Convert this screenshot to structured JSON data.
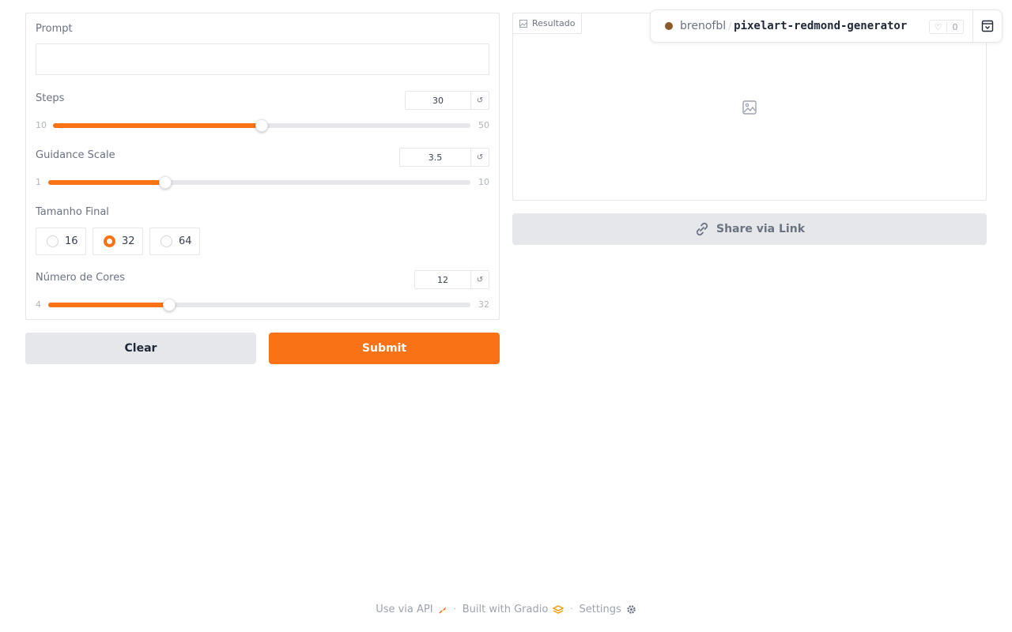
{
  "form": {
    "prompt_label": "Prompt",
    "prompt_value": "",
    "steps": {
      "label": "Steps",
      "value": "30",
      "min": "10",
      "max": "50",
      "fraction": 0.5
    },
    "guidance": {
      "label": "Guidance Scale",
      "value": "3.5",
      "min": "1",
      "max": "10",
      "fraction": 0.2778
    },
    "size": {
      "label": "Tamanho Final",
      "options": [
        "16",
        "32",
        "64"
      ],
      "selected": "32"
    },
    "colors": {
      "label": "Número de Cores",
      "value": "12",
      "min": "4",
      "max": "32",
      "fraction": 0.2857
    },
    "reset_glyph": "↺"
  },
  "buttons": {
    "clear": "Clear",
    "submit": "Submit"
  },
  "result": {
    "label": "Resultado",
    "share": "Share via Link"
  },
  "badge": {
    "user": "brenofbl",
    "slash": "/",
    "repo": "pixelart-redmond-generator",
    "likes": "0"
  },
  "footer": {
    "api": "Use via API",
    "built": "Built with Gradio",
    "settings": "Settings"
  },
  "theme": {
    "accent": "#f97316",
    "muted": "#e5e7eb"
  }
}
